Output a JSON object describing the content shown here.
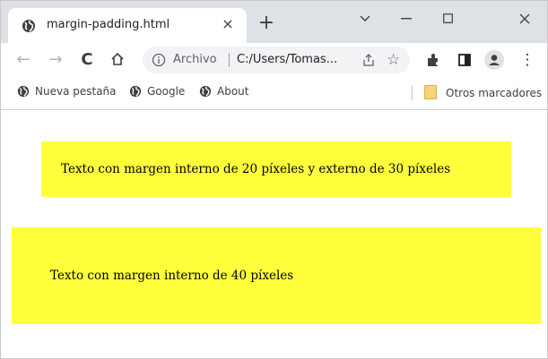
{
  "tab": {
    "title": "margin-padding.html",
    "close": "×",
    "favicon": "globe-icon"
  },
  "new_tab": "+",
  "window_controls": {
    "minimize": "minimize-icon",
    "maximize": "maximize-icon",
    "close": "close-icon",
    "tab_search": "chevron-down-icon"
  },
  "toolbar": {
    "back": "←",
    "forward": "→",
    "reload": "C",
    "home": "home-icon",
    "omnibox": {
      "scheme_label": "Archivo",
      "url": "C:/Users/Tomas...",
      "star": "☆"
    },
    "menu": "⋮"
  },
  "bookmarks": {
    "items": [
      {
        "label": "Nueva pestaña",
        "icon": "globe-icon"
      },
      {
        "label": "Google",
        "icon": "globe-icon"
      },
      {
        "label": "About",
        "icon": "globe-icon"
      }
    ],
    "other": "Otros marcadores"
  },
  "page": {
    "box1_text": "Texto con margen interno de 20 píxeles y externo de 30 píxeles",
    "box2_text": "Texto con margen interno de 40 píxeles",
    "box_color": "#ffff3c"
  }
}
